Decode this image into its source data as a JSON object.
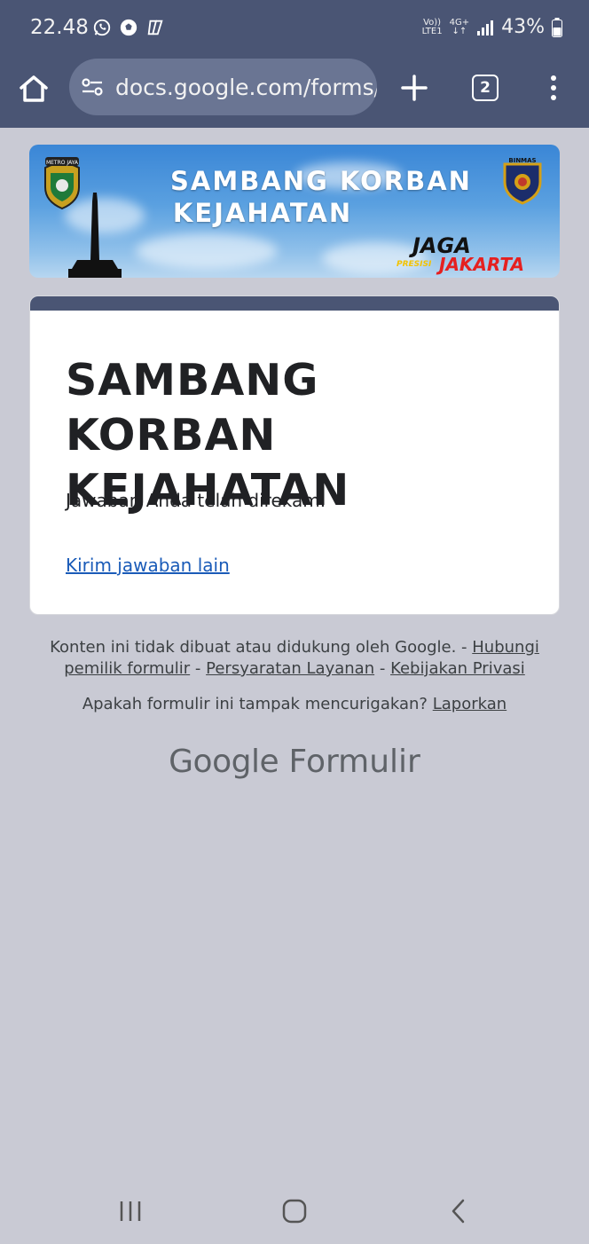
{
  "status_bar": {
    "time": "22.48",
    "network_top": "Vo))",
    "network_bottom": "LTE1",
    "network_gen": "4G+",
    "battery": "43%"
  },
  "browser": {
    "url": "docs.google.com/forms/",
    "tab_count": "2"
  },
  "banner": {
    "title_line1": "SAMBANG KORBAN",
    "title_line2": "KEJAHATAN",
    "badge_left_text": "METRO JAYA",
    "badge_right_text": "BINMAS",
    "jaga": "JAGA",
    "presisi": "PRESISI",
    "jakarta": "JAKARTA"
  },
  "form": {
    "title": "SAMBANG KORBAN KEJAHATAN",
    "confirmation": "Jawaban Anda telah direkam.",
    "another_response": "Kirim jawaban lain"
  },
  "footer": {
    "disclaimer": "Konten ini tidak dibuat atau didukung oleh Google. - ",
    "contact_owner": "Hubungi pemilik formulir",
    "sep1": " - ",
    "terms": "Persyaratan Layanan",
    "sep2": " - ",
    "privacy": "Kebijakan Privasi",
    "suspicious": "Apakah formulir ini tampak mencurigakan? ",
    "report": "Laporkan",
    "brand_google": "Google",
    "brand_product": "Formulir"
  },
  "colors": {
    "chrome": "#4a5574",
    "page_bg": "#c9cad4",
    "link": "#1a5bb8",
    "card_accent": "#4a5574"
  }
}
